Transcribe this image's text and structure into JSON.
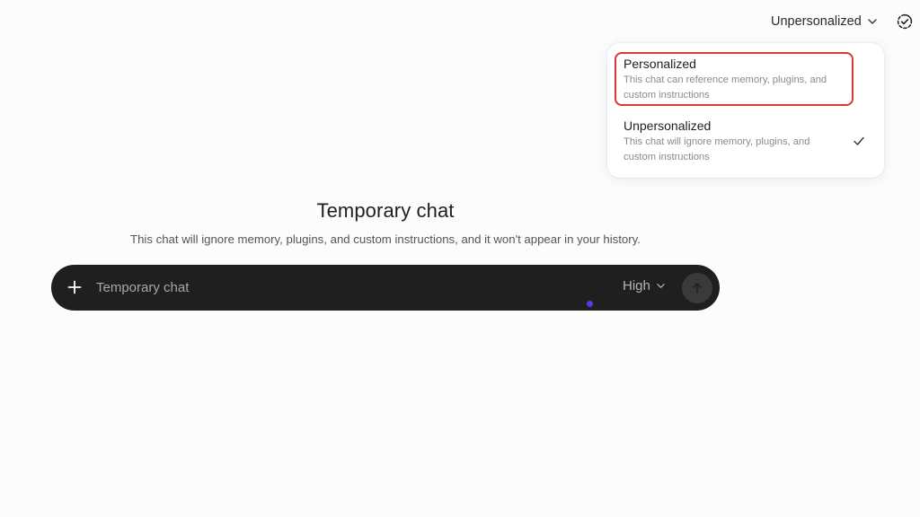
{
  "header": {
    "mode_label": "Unpersonalized"
  },
  "dropdown": {
    "options": [
      {
        "title": "Personalized",
        "description_line1": "This chat can reference memory, plugins, and",
        "description_line2": "custom instructions",
        "selected": false,
        "highlighted": true
      },
      {
        "title": "Unpersonalized",
        "description_line1": "This chat will ignore memory, plugins, and",
        "description_line2": "custom instructions",
        "selected": true,
        "highlighted": false
      }
    ]
  },
  "main": {
    "title": "Temporary chat",
    "subtitle": "This chat will ignore memory, plugins, and custom instructions, and it won't appear in your history."
  },
  "composer": {
    "placeholder": "Temporary chat",
    "effort_label": "High"
  },
  "colors": {
    "highlight_border": "#d9363e",
    "composer_bg": "#1f1f20",
    "cursor": "#4a3ff0"
  },
  "icons": {
    "mode_chevron": "chevron-down-icon",
    "temporary_toggle": "temporary-chat-check-icon",
    "selected_check": "checkmark-icon",
    "attach": "plus-icon",
    "effort_chevron": "chevron-down-icon",
    "send": "arrow-up-icon"
  }
}
